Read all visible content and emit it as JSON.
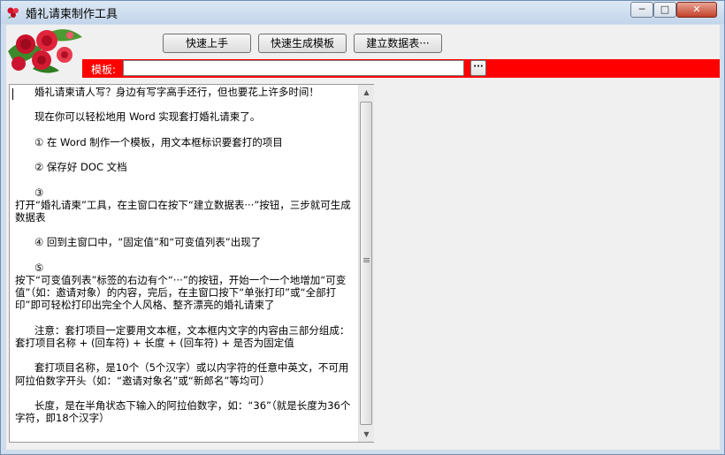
{
  "window": {
    "title": "婚礼请柬制作工具",
    "controls": {
      "minimize": "─",
      "maximize": "□",
      "close": "✕"
    }
  },
  "toolbar": {
    "quick_start": "快速上手",
    "quick_template": "快速生成模板",
    "build_db": "建立数据表···"
  },
  "template": {
    "label": "模板:",
    "value": "",
    "browse": "···"
  },
  "content": {
    "paragraphs": [
      "      婚礼请柬请人写？身边有写字高手还行，但也要花上许多时间！",
      "",
      "      现在你可以轻松地用 Word 实现套打婚礼请柬了。",
      "",
      "      ① 在 Word 制作一个模板，用文本框标识要套打的项目",
      "",
      "      ② 保存好 DOC 文档",
      "",
      "      ③",
      "打开“婚礼请柬”工具，在主窗口在按下“建立数据表···”按钮，三步就可生成数据表",
      "",
      "      ④ 回到主窗口中，“固定值”和“可变值列表”出现了",
      "",
      "      ⑤",
      "按下“可变值列表”标签的右边有个“···”的按钮，开始一个一个地增加“可变值”（如：邀请对象）的内容，完后，在主窗口按下“单张打印”或“全部打印”即可轻松打印出完全个人风格、整齐漂亮的婚礼请柬了",
      "",
      "      注意：套打项目一定要用文本框，文本框内文字的内容由三部分组成：套打项目名称 + (回车符) + 长度 + (回车符) + 是否为固定值",
      "",
      "      套打项目名称，是10个（5个汉字）或以内字符的任意中英文，不可用阿拉伯数字开头（如：“邀请对象名”或“新郎名”等均可）",
      "",
      "      长度，是在半角状态下输入的阿拉伯数字，如：“36”（就是长度为36个字符，即18个汉字）"
    ]
  },
  "colors": {
    "bar": "#ff0000"
  },
  "icons": {
    "app": "rose-icon",
    "logo": "rose-bouquet-logo",
    "scroll_up": "scroll-up-arrow-icon",
    "scroll_down": "scroll-down-arrow-icon",
    "grip": "scroll-grip-icon"
  }
}
